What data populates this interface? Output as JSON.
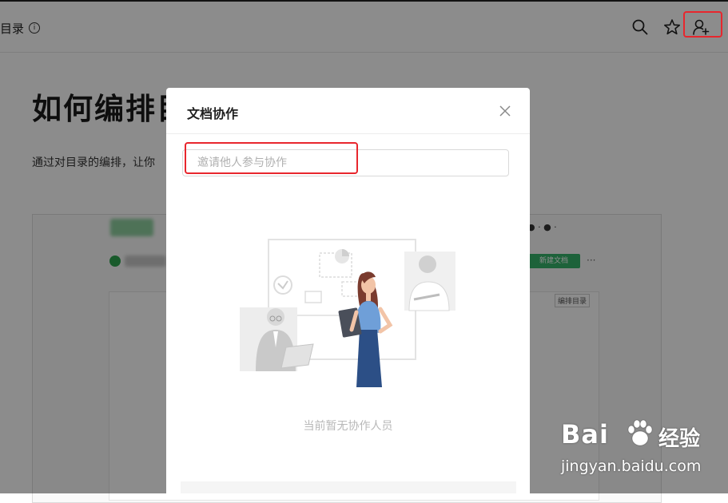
{
  "header": {
    "breadcrumb": "目录",
    "info_glyph": "i",
    "icons": [
      "search-icon",
      "star-icon",
      "add-user-icon"
    ]
  },
  "document": {
    "title": "如何编排目",
    "description": "通过对目录的编排，让你",
    "preview": {
      "new_doc_button": "新建文档",
      "more": "···",
      "toc_label": "编排目录"
    }
  },
  "modal": {
    "title": "文档协作",
    "invite_placeholder": "邀请他人参与协作",
    "invite_value": "",
    "empty_state": "当前暂无协作人员"
  },
  "watermark": {
    "logo": "Bai",
    "brand_cn": "经验",
    "url": "jingyan.baidu.com"
  },
  "colors": {
    "highlight": "#e8262d",
    "accent_green": "#36b36b",
    "overlay": "rgba(0,0,0,0.45)"
  }
}
